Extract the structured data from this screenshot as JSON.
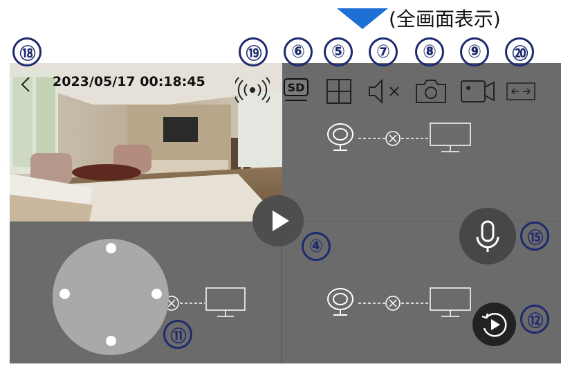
{
  "header": {
    "fullscreen_label": "(全画面表示)",
    "arrow_color": "#1d6fd6"
  },
  "video": {
    "timestamp": "2023/05/17 00:18:45"
  },
  "callouts": {
    "c18": "⑱",
    "c19": "⑲",
    "c6": "⑥",
    "c5": "⑤",
    "c7": "⑦",
    "c8": "⑧",
    "c9": "⑨",
    "c20": "⑳",
    "c4": "④",
    "c15": "⑮",
    "c11": "⑪",
    "c12": "⑫"
  },
  "toolbar": {
    "sd_label": "SD"
  },
  "icons": [
    "back-icon",
    "signal-icon",
    "sd-quality-icon",
    "grid-split-icon",
    "mute-icon",
    "snapshot-icon",
    "record-icon",
    "fit-screen-icon",
    "play-icon",
    "microphone-icon",
    "replay-icon",
    "camera-offline-icon",
    "monitor-icon"
  ],
  "colors": {
    "panel": "#6b6b6b",
    "callout": "#1e2a6e",
    "accent": "#1d6fd6"
  }
}
